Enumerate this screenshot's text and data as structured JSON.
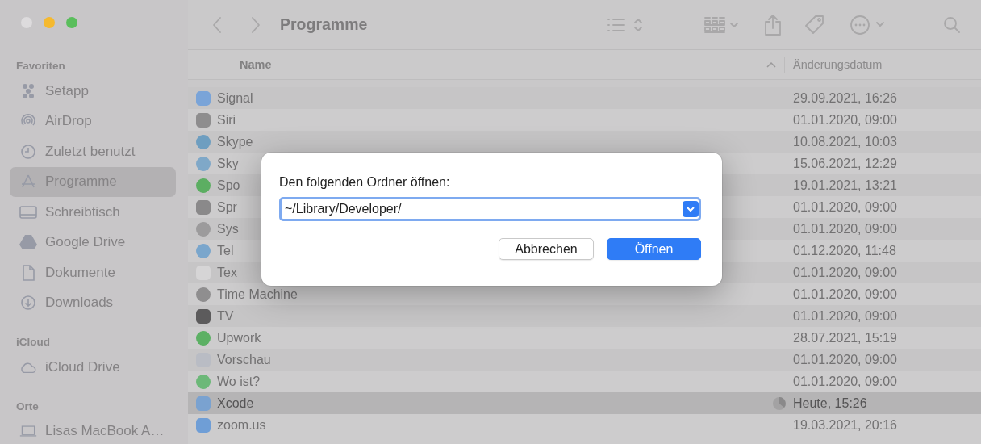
{
  "window": {
    "title": "Programme"
  },
  "sidebar": {
    "sections": [
      {
        "title": "Favoriten",
        "items": [
          {
            "label": "Setapp",
            "selected": false
          },
          {
            "label": "AirDrop",
            "selected": false
          },
          {
            "label": "Zuletzt benutzt",
            "selected": false
          },
          {
            "label": "Programme",
            "selected": true
          },
          {
            "label": "Schreibtisch",
            "selected": false
          },
          {
            "label": "Google Drive",
            "selected": false
          },
          {
            "label": "Dokumente",
            "selected": false
          },
          {
            "label": "Downloads",
            "selected": false
          }
        ]
      },
      {
        "title": "iCloud",
        "items": [
          {
            "label": "iCloud Drive",
            "selected": false
          }
        ]
      },
      {
        "title": "Orte",
        "items": [
          {
            "label": "Lisas MacBook A…",
            "selected": false
          }
        ]
      }
    ]
  },
  "table": {
    "columns": [
      {
        "label": "Name",
        "sorted": true
      },
      {
        "label": "Änderungsdatum",
        "sorted": false
      }
    ],
    "rows": [
      {
        "name": "Signal",
        "date": "29.09.2021, 16:26",
        "selected": false,
        "status_icon": false
      },
      {
        "name": "Siri",
        "date": "01.01.2020, 09:00",
        "selected": false,
        "status_icon": false
      },
      {
        "name": "Skype",
        "date": "10.08.2021, 10:03",
        "selected": false,
        "status_icon": false
      },
      {
        "name": "Sky",
        "date": "15.06.2021, 12:29",
        "selected": false,
        "status_icon": false
      },
      {
        "name": "Spo",
        "date": "19.01.2021, 13:21",
        "selected": false,
        "status_icon": false
      },
      {
        "name": "Spr",
        "date": "01.01.2020, 09:00",
        "selected": false,
        "status_icon": false
      },
      {
        "name": "Sys",
        "date": "01.01.2020, 09:00",
        "selected": false,
        "status_icon": false
      },
      {
        "name": "Tel",
        "date": "01.12.2020, 11:48",
        "selected": false,
        "status_icon": false
      },
      {
        "name": "Tex",
        "date": "01.01.2020, 09:00",
        "selected": false,
        "status_icon": false
      },
      {
        "name": "Time Machine",
        "date": "01.01.2020, 09:00",
        "selected": false,
        "status_icon": false
      },
      {
        "name": "TV",
        "date": "01.01.2020, 09:00",
        "selected": false,
        "status_icon": false
      },
      {
        "name": "Upwork",
        "date": "28.07.2021, 15:19",
        "selected": false,
        "status_icon": false
      },
      {
        "name": "Vorschau",
        "date": "01.01.2020, 09:00",
        "selected": false,
        "status_icon": false
      },
      {
        "name": "Wo ist?",
        "date": "01.01.2020, 09:00",
        "selected": false,
        "status_icon": false
      },
      {
        "name": "Xcode",
        "date": "Heute, 15:26",
        "selected": true,
        "status_icon": true
      },
      {
        "name": "zoom.us",
        "date": "19.03.2021, 20:16",
        "selected": false,
        "status_icon": false
      }
    ]
  },
  "dialog": {
    "label": "Den folgenden Ordner öffnen:",
    "field": {
      "value": "~/Library/Developer/"
    },
    "buttons": [
      {
        "label": "Abbrechen",
        "default": false
      },
      {
        "label": "Öffnen",
        "default": true
      }
    ]
  }
}
